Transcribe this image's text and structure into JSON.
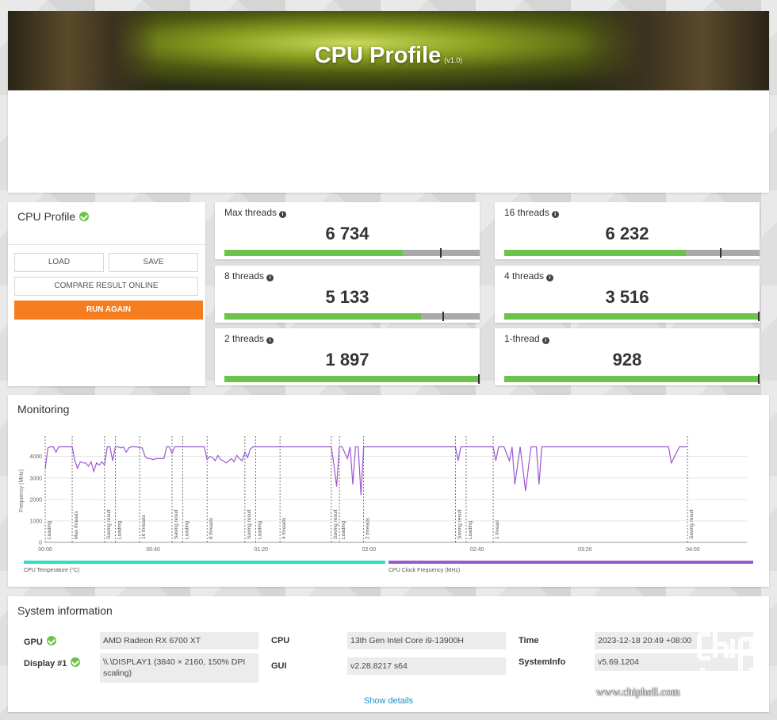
{
  "hero": {
    "title": "CPU Profile",
    "version": "(v1.0)"
  },
  "panel": {
    "title": "CPU Profile",
    "load": "LOAD",
    "save": "SAVE",
    "compare": "COMPARE RESULT ONLINE",
    "run": "RUN AGAIN"
  },
  "scores": [
    {
      "label": "Max threads",
      "value": "6 734",
      "fill": 0.7,
      "marker": 0.85
    },
    {
      "label": "16 threads",
      "value": "6 232",
      "fill": 0.71,
      "marker": 0.85
    },
    {
      "label": "8 threads",
      "value": "5 133",
      "fill": 0.77,
      "marker": 0.86
    },
    {
      "label": "4 threads",
      "value": "3 516",
      "fill": 1.0,
      "marker": 1.0
    },
    {
      "label": "2 threads",
      "value": "1 897",
      "fill": 1.0,
      "marker": 1.0
    },
    {
      "label": "1-thread",
      "value": "928",
      "fill": 1.0,
      "marker": 1.0
    }
  ],
  "monitoring": {
    "title": "Monitoring"
  },
  "chart_data": {
    "type": "line",
    "ylabel": "Frequency (MHz)",
    "ylim": [
      0,
      4800
    ],
    "yticks": [
      "0",
      "1000",
      "2000",
      "3000",
      "4000"
    ],
    "xticks": [
      "00:00",
      "00:40",
      "01:20",
      "02:00",
      "02:40",
      "03:20",
      "04:00"
    ],
    "markers": [
      {
        "t": 0,
        "label": "Loading"
      },
      {
        "t": 10,
        "label": "Max threads"
      },
      {
        "t": 22,
        "label": "Saving result"
      },
      {
        "t": 26,
        "label": "Loading"
      },
      {
        "t": 35,
        "label": "16 threads"
      },
      {
        "t": 47,
        "label": "Saving result"
      },
      {
        "t": 51,
        "label": "Loading"
      },
      {
        "t": 60,
        "label": "8 threads"
      },
      {
        "t": 74,
        "label": "Saving result"
      },
      {
        "t": 78,
        "label": "Loading"
      },
      {
        "t": 87,
        "label": "4 threads"
      },
      {
        "t": 106,
        "label": "Saving result"
      },
      {
        "t": 109,
        "label": "Loading"
      },
      {
        "t": 118,
        "label": "2 threads"
      },
      {
        "t": 152,
        "label": "Saving result"
      },
      {
        "t": 156,
        "label": "Loading"
      },
      {
        "t": 166,
        "label": "1 thread"
      },
      {
        "t": 238,
        "label": "Saving result"
      }
    ],
    "series": [
      {
        "name": "CPU Clock Frequency (MHz)",
        "x": [
          0,
          1,
          2,
          3,
          4,
          5,
          6,
          7,
          8,
          9,
          10,
          11,
          12,
          13,
          14,
          15,
          16,
          17,
          18,
          19,
          20,
          21,
          22,
          23,
          24,
          25,
          26,
          27,
          28,
          29,
          30,
          31,
          32,
          33,
          34,
          35,
          36,
          37,
          38,
          39,
          40,
          41,
          42,
          43,
          44,
          45,
          46,
          47,
          48,
          49,
          50,
          51,
          52,
          53,
          54,
          55,
          56,
          57,
          58,
          59,
          60,
          61,
          62,
          63,
          64,
          65,
          66,
          67,
          68,
          69,
          70,
          71,
          72,
          73,
          74,
          75,
          76,
          77,
          78,
          80,
          84,
          86,
          88,
          90,
          92,
          95,
          100,
          104,
          106,
          107,
          108,
          109,
          110,
          112,
          113,
          114,
          115,
          116,
          117,
          118,
          120,
          130,
          140,
          150,
          152,
          153,
          154,
          156,
          160,
          164,
          166,
          167,
          168,
          170,
          172,
          173,
          174,
          176,
          178,
          180,
          182,
          183,
          184,
          186,
          190,
          200,
          210,
          220,
          228,
          230,
          231,
          232,
          235,
          238
        ],
        "values": [
          3400,
          4400,
          4450,
          4450,
          4200,
          4450,
          4450,
          4450,
          4450,
          4450,
          4450,
          3800,
          3450,
          3750,
          3700,
          3700,
          3550,
          3750,
          3300,
          3700,
          3600,
          3750,
          3600,
          4450,
          4450,
          3800,
          4450,
          4450,
          4400,
          4450,
          4200,
          4400,
          4450,
          4450,
          4450,
          4400,
          4400,
          4000,
          3900,
          3900,
          3850,
          3900,
          3900,
          3900,
          3900,
          4450,
          4450,
          4150,
          4450,
          4450,
          4450,
          4450,
          4450,
          4450,
          4450,
          4450,
          4450,
          4450,
          4450,
          4450,
          3850,
          4000,
          3950,
          3800,
          4050,
          3850,
          3800,
          3700,
          3800,
          3900,
          3750,
          4050,
          3900,
          3800,
          4200,
          3950,
          4350,
          4450,
          4450,
          4450,
          4450,
          4450,
          4450,
          4450,
          4450,
          4450,
          4450,
          4450,
          4450,
          3600,
          2600,
          4450,
          4450,
          3900,
          4450,
          2700,
          4450,
          4450,
          2200,
          4450,
          4450,
          4450,
          4450,
          4450,
          4450,
          3800,
          4450,
          4450,
          4450,
          4450,
          4450,
          3800,
          4450,
          4450,
          3800,
          4450,
          2700,
          4450,
          2400,
          4450,
          4450,
          2700,
          4450,
          4450,
          4450,
          4450,
          4450,
          4450,
          4450,
          4450,
          4450,
          3700,
          4450,
          4450
        ]
      },
      {
        "name": "CPU Temperature (°C)"
      }
    ],
    "legend": "bottom"
  },
  "sysinfo": {
    "title": "System information",
    "gpu_label": "GPU",
    "gpu": "AMD Radeon RX 6700 XT",
    "display_label": "Display #1",
    "display": "\\\\.\\DISPLAY1 (3840 × 2160, 150% DPI scaling)",
    "cpu_label": "CPU",
    "cpu": "13th Gen Intel Core i9-13900H",
    "gui_label": "GUI",
    "gui": "v2.28.8217 s64",
    "time_label": "Time",
    "time": "2023-12-18 20:49 +08:00",
    "sysinfo_label": "SystemInfo",
    "sysinfo": "v5.69.1204",
    "show_details": "Show details"
  },
  "watermark": {
    "text": "www.chiphell.com"
  },
  "colors": {
    "green": "#6cc24a",
    "orange": "#f57d1f",
    "purple": "#9b59d0",
    "teal": "#2de0c0",
    "link": "#1a8fc5"
  }
}
